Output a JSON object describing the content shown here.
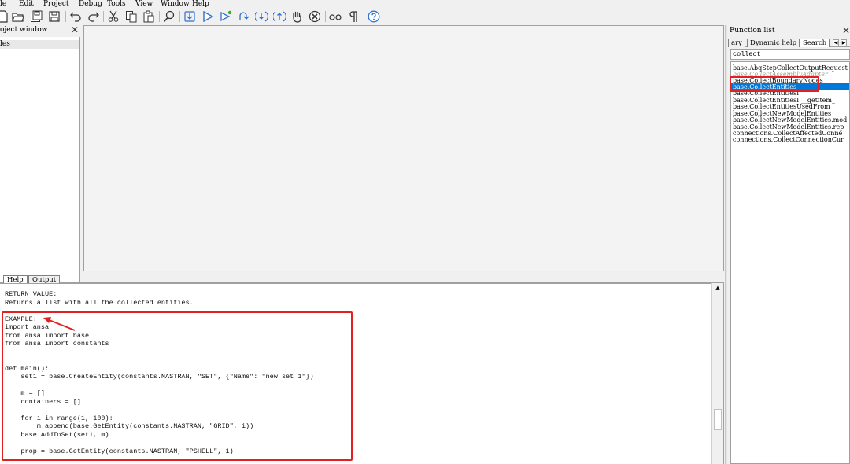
{
  "menu": [
    "le",
    "Edit",
    "Project",
    "Debug",
    "Tools",
    "View",
    "Window",
    "Help"
  ],
  "toolbar": {
    "icons": [
      "new-file-icon",
      "open-folder-icon",
      "save-all-icon",
      "save-icon",
      "undo-icon",
      "redo-icon",
      "cut-icon",
      "copy-icon",
      "paste-icon",
      "find-icon",
      "import-icon",
      "run-icon",
      "run-selection-icon",
      "step-over-icon",
      "step-into-icon",
      "step-out-icon",
      "stop-hand-icon",
      "terminate-icon",
      "watch-glasses-icon",
      "paragraph-icon",
      "help-icon"
    ],
    "accent": "#2f6fd0"
  },
  "project": {
    "title": "oject window",
    "close": "✕",
    "item": "les"
  },
  "bottom_tabs": [
    "Help",
    "Output"
  ],
  "help": {
    "text": "RETURN VALUE:\nReturns a list with all the collected entities.\n\nEXAMPLE:\nimport ansa\nfrom ansa import base\nfrom ansa import constants\n\n\ndef main():\n    set1 = base.CreateEntity(constants.NASTRAN, \"SET\", {\"Name\": \"new set 1\"})\n\n    m = []\n    containers = []\n\n    for i in range(1, 100):\n        m.append(base.GetEntity(constants.NASTRAN, \"GRID\", i))\n    base.AddToSet(set1, m)\n\n    prop = base.GetEntity(constants.NASTRAN, \"PSHELL\", 1)",
    "scroll_up": "▲"
  },
  "function_panel": {
    "title": "Function list",
    "close": "✕",
    "tabs": [
      "ary",
      "Dynamic help",
      "Search"
    ],
    "nav_left": "◀",
    "nav_right": "▶",
    "search_value": "collect",
    "items": [
      {
        "label": "base.AbqStepCollectOutputRequest",
        "state": "normal"
      },
      {
        "label": "base.CollectAssemblyAdapter",
        "state": "deprecated"
      },
      {
        "label": "base.CollectBoundaryNodes",
        "state": "normal"
      },
      {
        "label": "base.CollectEntities",
        "state": "selected"
      },
      {
        "label": "base.CollectEntitiesI",
        "state": "normal"
      },
      {
        "label": "base.CollectEntitiesI.__getitem_",
        "state": "normal"
      },
      {
        "label": "base.CollectEntitiesUsedFrom",
        "state": "normal"
      },
      {
        "label": "base.CollectNewModelEntities",
        "state": "normal"
      },
      {
        "label": "base.CollectNewModelEntities.mod",
        "state": "normal"
      },
      {
        "label": "base.CollectNewModelEntities.rep",
        "state": "normal"
      },
      {
        "label": "connections.CollectAffectedConne",
        "state": "normal"
      },
      {
        "label": "connections.CollectConnectionCur",
        "state": "normal"
      }
    ]
  },
  "annotation_color": "#e41f1f"
}
